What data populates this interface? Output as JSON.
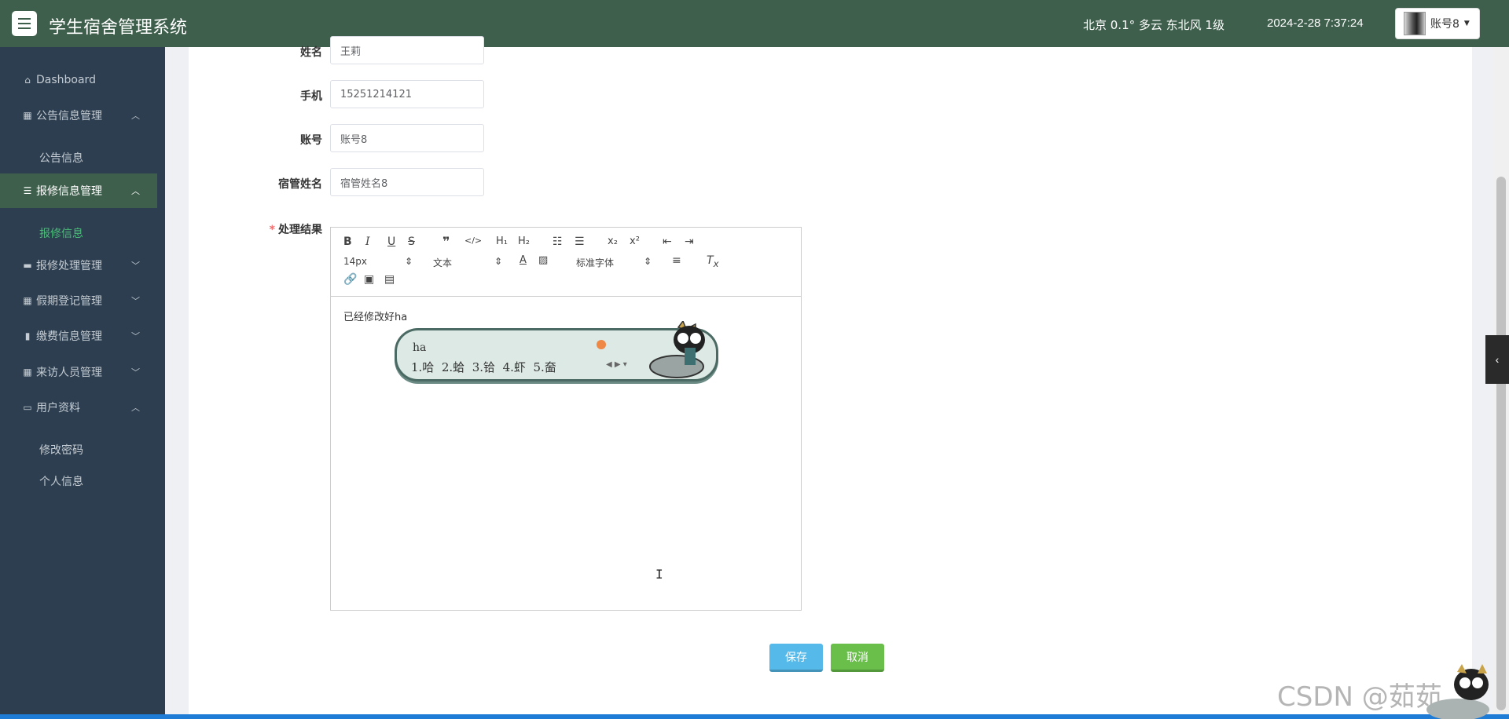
{
  "header": {
    "title": "学生宿舍管理系统",
    "weather": "北京  0.1°  多云  东北风  1级",
    "datetime": "2024-2-28 7:37:24",
    "user": "账号8"
  },
  "sidebar": {
    "dashboard": "Dashboard",
    "groups": [
      {
        "label": "公告信息管理",
        "icon": "grid-icon",
        "expanded": true
      },
      {
        "label": "报修信息管理",
        "icon": "list-icon",
        "expanded": true
      },
      {
        "label": "报修处理管理",
        "icon": "comment-icon",
        "expanded": false
      },
      {
        "label": "假期登记管理",
        "icon": "grid-icon",
        "expanded": false
      },
      {
        "label": "缴费信息管理",
        "icon": "bar-chart-icon",
        "expanded": false
      },
      {
        "label": "来访人员管理",
        "icon": "grid-icon",
        "expanded": false
      },
      {
        "label": "用户资料",
        "icon": "card-icon",
        "expanded": true
      }
    ],
    "subs": {
      "notice": "公告信息",
      "repair": "报修信息",
      "change_password": "修改密码",
      "profile": "个人信息"
    }
  },
  "form": {
    "name_label": "姓名",
    "name_value": "王莉",
    "phone_label": "手机",
    "phone_value": "15251214121",
    "account_label": "账号",
    "account_value": "账号8",
    "manager_label": "宿管姓名",
    "manager_value": "宿管姓名8",
    "result_label": "处理结果",
    "required_mark": "*"
  },
  "editor": {
    "font_size": "14px",
    "block_type": "文本",
    "font_family": "标准字体",
    "content": "已经修改好ha"
  },
  "ime": {
    "pinyin": "ha",
    "candidates": [
      "1.哈",
      "2.蛤",
      "3.铪",
      "4.虾",
      "5.奤"
    ]
  },
  "buttons": {
    "save": "保存",
    "cancel": "取消"
  },
  "watermark": "CSDN @茹茹",
  "colors": {
    "header": "#3e5f4b",
    "sidebar": "#2c3e50",
    "active_sub": "#4dbb7a",
    "save": "#55b9e9",
    "cancel": "#6abf4b"
  }
}
